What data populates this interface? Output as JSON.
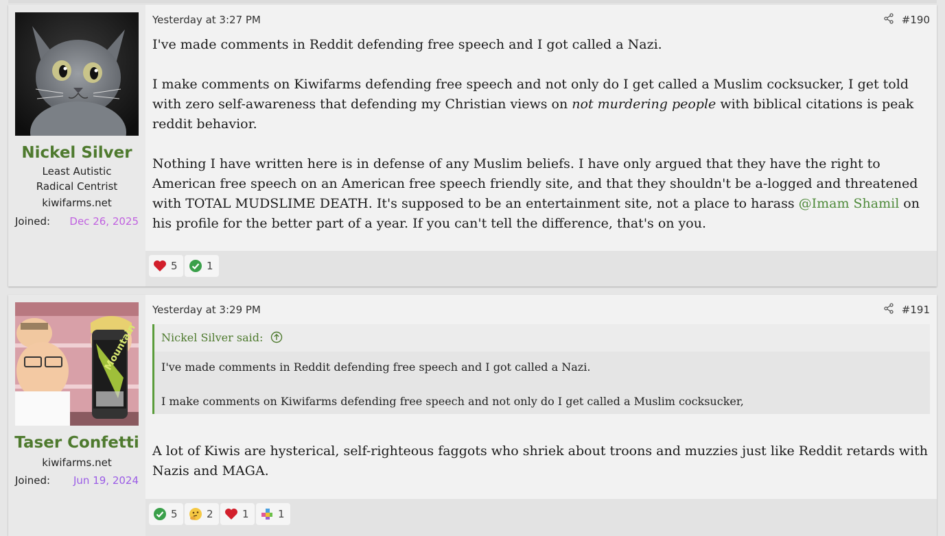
{
  "posts": [
    {
      "timestamp": "Yesterday at 3:27 PM",
      "number": "#190",
      "user": {
        "name": "Nickel Silver",
        "title": "Least Autistic Radical Centrist",
        "site": "kiwifarms.net",
        "joined_label": "Joined:",
        "joined": "Dec 26, 2025",
        "joined_color": "#c061e0"
      },
      "paragraphs": {
        "p1": "I've made comments in Reddit defending free speech and I got called a Nazi.",
        "p2a": "I make comments on Kiwifarms defending free speech and not only do I get called a Muslim cocksucker, I get told with zero self-awareness that defending my Christian views on ",
        "p2em": "not murdering people",
        "p2b": " with biblical citations is peak reddit behavior.",
        "p3a": "Nothing I have written here is in defense of any Muslim beliefs. I have only argued that they have the right to American free speech on an American free speech friendly site, and that they shouldn't be a-logged and threatened with TOTAL MUDSLIME DEATH. It's supposed to be an entertainment site, not a place to harass ",
        "p3mention": "@Imam Shamil",
        "p3b": " on his profile for the better part of a year. If you can't tell the difference, that's on you."
      },
      "reactions": [
        {
          "icon": "heart-icon",
          "count": "5"
        },
        {
          "icon": "check-icon",
          "count": "1"
        }
      ]
    },
    {
      "timestamp": "Yesterday at 3:29 PM",
      "number": "#191",
      "user": {
        "name": "Taser Confetti",
        "site": "kiwifarms.net",
        "joined_label": "Joined:",
        "joined": "Jun 19, 2024",
        "joined_color": "#9b5ce6"
      },
      "quote": {
        "author": "Nickel Silver said:",
        "line1": "I've made comments in Reddit defending free speech and I got called a Nazi.",
        "line2": "I make comments on Kiwifarms defending free speech and not only do I get called a Muslim cocksucker,"
      },
      "body": "A lot of Kiwis are hysterical, self-righteous faggots who shriek about troons and muzzies just like Reddit retards with Nazis and MAGA.",
      "reactions": [
        {
          "icon": "check-icon",
          "count": "5"
        },
        {
          "icon": "thinking-icon",
          "count": "2"
        },
        {
          "icon": "heart-icon",
          "count": "1"
        },
        {
          "icon": "puzzle-icon",
          "count": "1"
        }
      ]
    }
  ],
  "icons": {
    "share": "share-icon",
    "jump": "arrow-up-circle-icon"
  },
  "colors": {
    "username": "#4e7a2e",
    "quote_border": "#5a9c3a",
    "mention": "#4e8a3a"
  }
}
